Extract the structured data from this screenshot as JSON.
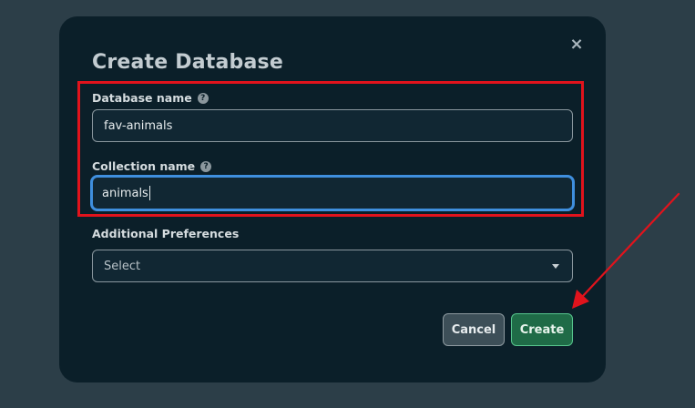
{
  "dialog": {
    "title": "Create Database",
    "close_icon": "×"
  },
  "fields": {
    "database_name": {
      "label": "Database name",
      "help_icon": "?",
      "value": "fav-animals"
    },
    "collection_name": {
      "label": "Collection name",
      "help_icon": "?",
      "value": "animals"
    },
    "additional_preferences": {
      "label": "Additional Preferences",
      "selected": "Select"
    }
  },
  "buttons": {
    "cancel": "Cancel",
    "create": "Create"
  },
  "annotation": {
    "highlight_color": "#e1131c",
    "arrow_color": "#e1131c"
  }
}
